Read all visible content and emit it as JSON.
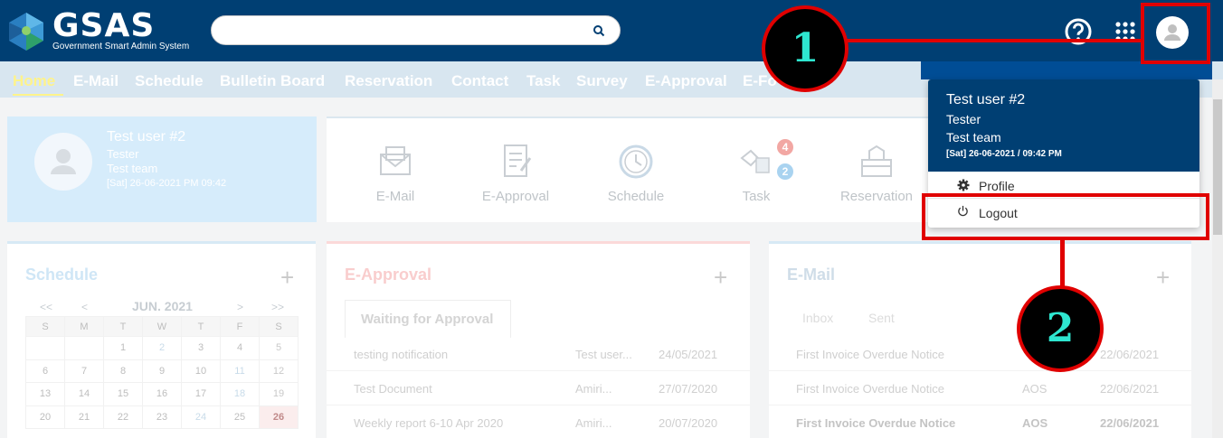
{
  "header": {
    "logo_text": "GSAS",
    "logo_subtitle": "Government Smart Admin System",
    "search_placeholder": "",
    "icons": [
      "search-icon",
      "help-icon",
      "apps-grid-icon",
      "user-avatar-icon"
    ]
  },
  "menu": {
    "items": [
      "Home",
      "E-Mail",
      "Schedule",
      "Bulletin Board",
      "Reservation",
      "Contact",
      "Task",
      "Survey",
      "E-Approval",
      "E-Fo"
    ],
    "active": "Home"
  },
  "profile_card": {
    "name": "Test user #2",
    "role": "Tester",
    "team": "Test team",
    "datetime": "[Sat] 26-06-2021 PM 09:42"
  },
  "quick_menu": {
    "items": [
      {
        "label": "E-Mail",
        "icon": "mail-icon"
      },
      {
        "label": "E-Approval",
        "icon": "approval-icon"
      },
      {
        "label": "Schedule",
        "icon": "clock-icon"
      },
      {
        "label": "Task",
        "icon": "task-icon"
      },
      {
        "label": "Reservation",
        "icon": "reservation-icon"
      }
    ],
    "task_badges": [
      "4",
      "2"
    ]
  },
  "schedule": {
    "title": "Schedule",
    "plus": "+",
    "nav": {
      "prev_year": "<<",
      "prev": "<",
      "month": "JUN. 2021",
      "next": ">",
      "next_year": ">>"
    },
    "weekdays": [
      "S",
      "M",
      "T",
      "W",
      "T",
      "F",
      "S"
    ],
    "weeks": [
      [
        "",
        "",
        "1",
        "2",
        "3",
        "4",
        "5"
      ],
      [
        "6",
        "7",
        "8",
        "9",
        "10",
        "11",
        "12"
      ],
      [
        "13",
        "14",
        "15",
        "16",
        "17",
        "18",
        "19"
      ],
      [
        "20",
        "21",
        "22",
        "23",
        "24",
        "25",
        "26"
      ]
    ],
    "today": "26"
  },
  "approval": {
    "title": "E-Approval",
    "plus": "+",
    "tab": "Waiting for Approval",
    "rows": [
      {
        "title": "testing notification",
        "author": "Test user...",
        "date": "24/05/2021"
      },
      {
        "title": "Test Document",
        "author": "Amiri...",
        "date": "27/07/2020"
      },
      {
        "title": "Weekly report 6-10 Apr 2020",
        "author": "Amiri...",
        "date": "20/07/2020"
      }
    ]
  },
  "email": {
    "title": "E-Mail",
    "plus": "+",
    "tabs": [
      "Inbox",
      "Sent"
    ],
    "rows": [
      {
        "subject": "First Invoice Overdue Notice",
        "sender": "",
        "date": "22/06/2021"
      },
      {
        "subject": "First Invoice Overdue Notice",
        "sender": "AOS",
        "date": "22/06/2021"
      },
      {
        "subject": "First Invoice Overdue Notice",
        "sender": "AOS",
        "date": "22/06/2021"
      }
    ]
  },
  "user_dropdown": {
    "name": "Test user #2",
    "role": "Tester",
    "team": "Test team",
    "datetime": "[Sat] 26-06-2021 / 09:42 PM",
    "profile_label": "Profile",
    "logout_label": "Logout"
  },
  "annotations": {
    "callout_1": "1",
    "callout_2": "2",
    "color": "#e00000"
  },
  "colors": {
    "header_bg": "#003f73",
    "menu_active": "#fff38a",
    "callout_text": "#2ee6d0"
  }
}
